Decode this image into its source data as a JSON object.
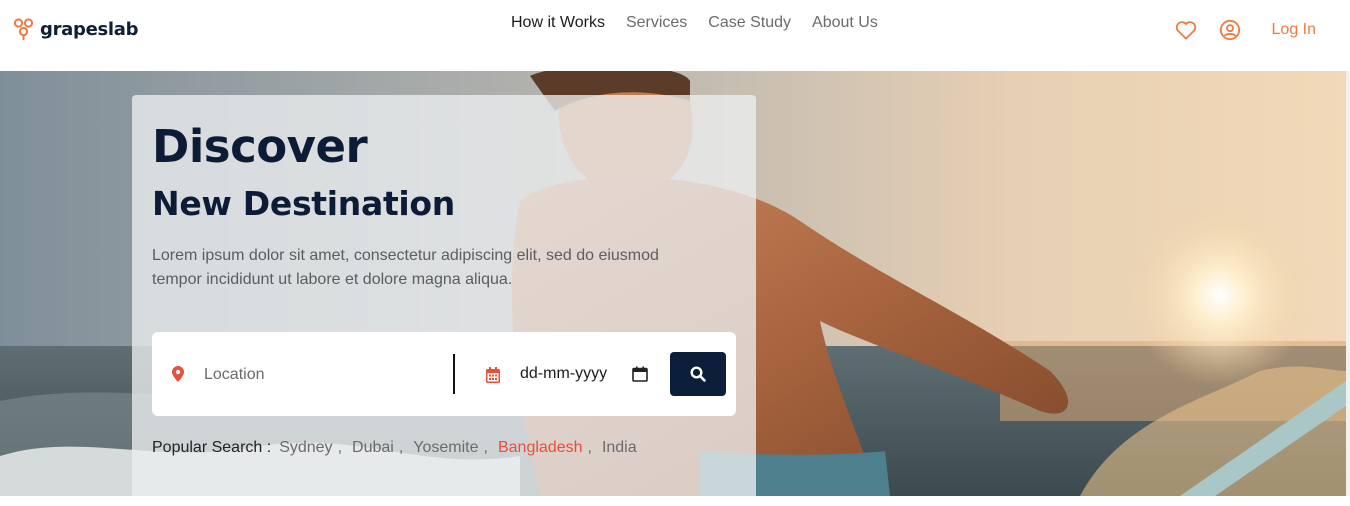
{
  "brand": {
    "name": "grapeslab",
    "accent": "#f07a45"
  },
  "nav": {
    "items": [
      {
        "label": "How it Works"
      },
      {
        "label": "Services"
      },
      {
        "label": "Case Study"
      },
      {
        "label": "About Us"
      }
    ],
    "active": "How it Works"
  },
  "header_actions": {
    "wishlist_icon": "heart-icon",
    "account_icon": "user-circle-icon",
    "login_label": "Log In"
  },
  "hero": {
    "title": "Discover",
    "subtitle": "New Destination",
    "description": "Lorem ipsum dolor sit amet, consectetur adipiscing elit, sed do eiusmod tempor incididunt ut labore et dolore magna aliqua.",
    "search": {
      "location_placeholder": "Location",
      "location_icon": "map-pin-icon",
      "date_value": "dd-mm-yyyy",
      "date_icon": "calendar-icon",
      "button_icon": "search-icon"
    },
    "popular": {
      "label": "Popular Search :",
      "items": [
        "Sydney",
        "Dubai",
        "Yosemite",
        "Bangladesh",
        "India"
      ],
      "highlighted": "Bangladesh",
      "highlight_color": "#e8503a"
    }
  },
  "colors": {
    "navy": "#0b1f3a",
    "accent": "#f07a45",
    "highlight": "#e8503a"
  }
}
